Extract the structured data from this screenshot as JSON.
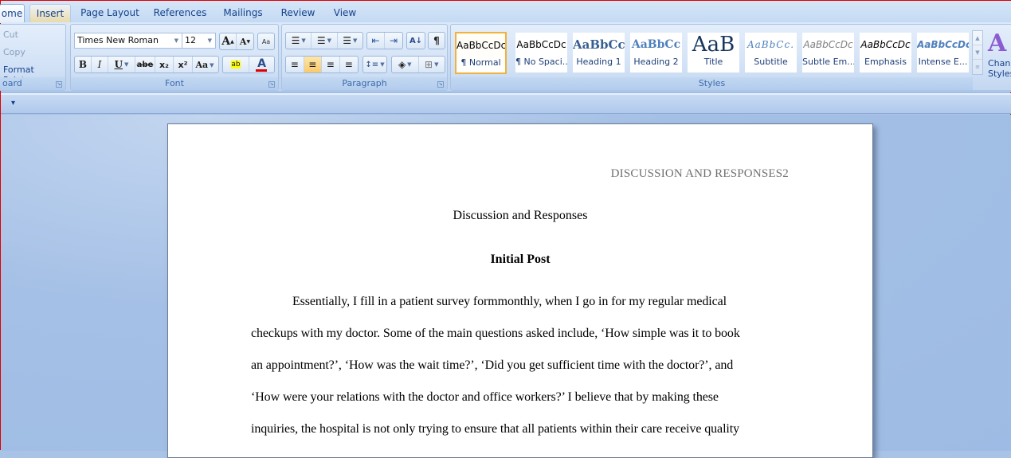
{
  "ribbon": {
    "tabs": [
      {
        "label": "ome",
        "state": "active"
      },
      {
        "label": "Insert",
        "state": "hover"
      },
      {
        "label": "Page Layout"
      },
      {
        "label": "References"
      },
      {
        "label": "Mailings"
      },
      {
        "label": "Review"
      },
      {
        "label": "View"
      }
    ],
    "clipboard": {
      "cut": "Cut",
      "copy": "Copy",
      "format_painter": "Format Painter",
      "group_label": "oard"
    },
    "font": {
      "font_name": "Times New Roman",
      "font_size": "12",
      "grow_font": "A",
      "shrink_font": "A",
      "clear_format": "Aa",
      "bold": "B",
      "italic": "I",
      "underline": "U",
      "strikethrough": "abe",
      "subscript": "x₂",
      "superscript": "x²",
      "change_case": "Aa",
      "highlight": "ab",
      "font_color": "A",
      "font_color_hex": "#e00000",
      "group_label": "Font"
    },
    "paragraph": {
      "bullets": "☰",
      "numbering": "☰",
      "multilevel": "☰",
      "decrease_indent": "⇤",
      "increase_indent": "⇥",
      "sort": "A↓",
      "show_marks": "¶",
      "align_left": "≡",
      "center": "≡",
      "align_right": "≡",
      "justify": "≡",
      "line_spacing": "↕≡",
      "shading": "◈",
      "borders": "⊞",
      "group_label": "Paragraph"
    },
    "styles": {
      "items": [
        {
          "sample": "AaBbCcDc",
          "name": "¶ Normal",
          "selected": true
        },
        {
          "sample": "AaBbCcDc",
          "name": "¶ No Spaci..."
        },
        {
          "sample": "AaBbCc",
          "name": "Heading 1"
        },
        {
          "sample": "AaBbCc",
          "name": "Heading 2"
        },
        {
          "sample": "AaB",
          "name": "Title"
        },
        {
          "sample": "AaBbCc.",
          "name": "Subtitle"
        },
        {
          "sample": "AaBbCcDc",
          "name": "Subtle Em..."
        },
        {
          "sample": "AaBbCcDc",
          "name": "Emphasis"
        },
        {
          "sample": "AaBbCcDc",
          "name": "Intense E..."
        }
      ],
      "change_styles_line1": "Chang",
      "change_styles_line2": "Styles",
      "group_label": "Styles"
    },
    "selection_highlight_hex": "#f0b23c"
  },
  "qat": {
    "customize_icon": "▾"
  },
  "document": {
    "header": "DISCUSSION  AND RESPONSES2",
    "title": "Discussion and Responses",
    "subheading": "Initial Post",
    "lines": [
      "Essentially, I fill in a patient survey formmonthly, when I go in for my regular medical",
      "checkups with my doctor. Some of the main questions asked include, ‘How simple was it to book",
      "an appointment?’, ‘How was the wait time?’, ‘Did you get sufficient time with the doctor?’, and",
      "‘How were your relations with the doctor and office workers?’ I believe that by making these",
      "inquiries, the hospital is not only trying to ensure that all patients within their care receive quality"
    ]
  }
}
